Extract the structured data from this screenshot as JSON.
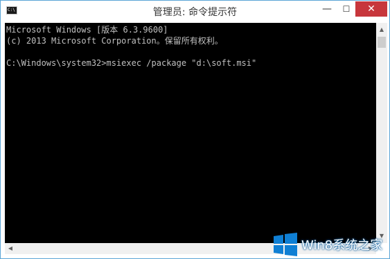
{
  "window": {
    "title": "管理员: 命令提示符",
    "app_icon_text": "C:\\",
    "controls": {
      "minimize_glyph": "—",
      "maximize_glyph": "☐",
      "close_glyph": "✕"
    }
  },
  "console": {
    "lines": [
      "Microsoft Windows [版本 6.3.9600]",
      "(c) 2013 Microsoft Corporation。保留所有权利。",
      "C:\\Windows\\system32>msiexec /package \"d:\\soft.msi\""
    ],
    "background": "#000000",
    "foreground": "#c0c0c0"
  },
  "scrollbars": {
    "up_glyph": "▲",
    "down_glyph": "▼",
    "left_glyph": "◀",
    "right_glyph": "▶"
  },
  "watermark": {
    "text": "Win8系统之家",
    "logo": "windows-logo-icon",
    "color": "#0f7fd4"
  }
}
